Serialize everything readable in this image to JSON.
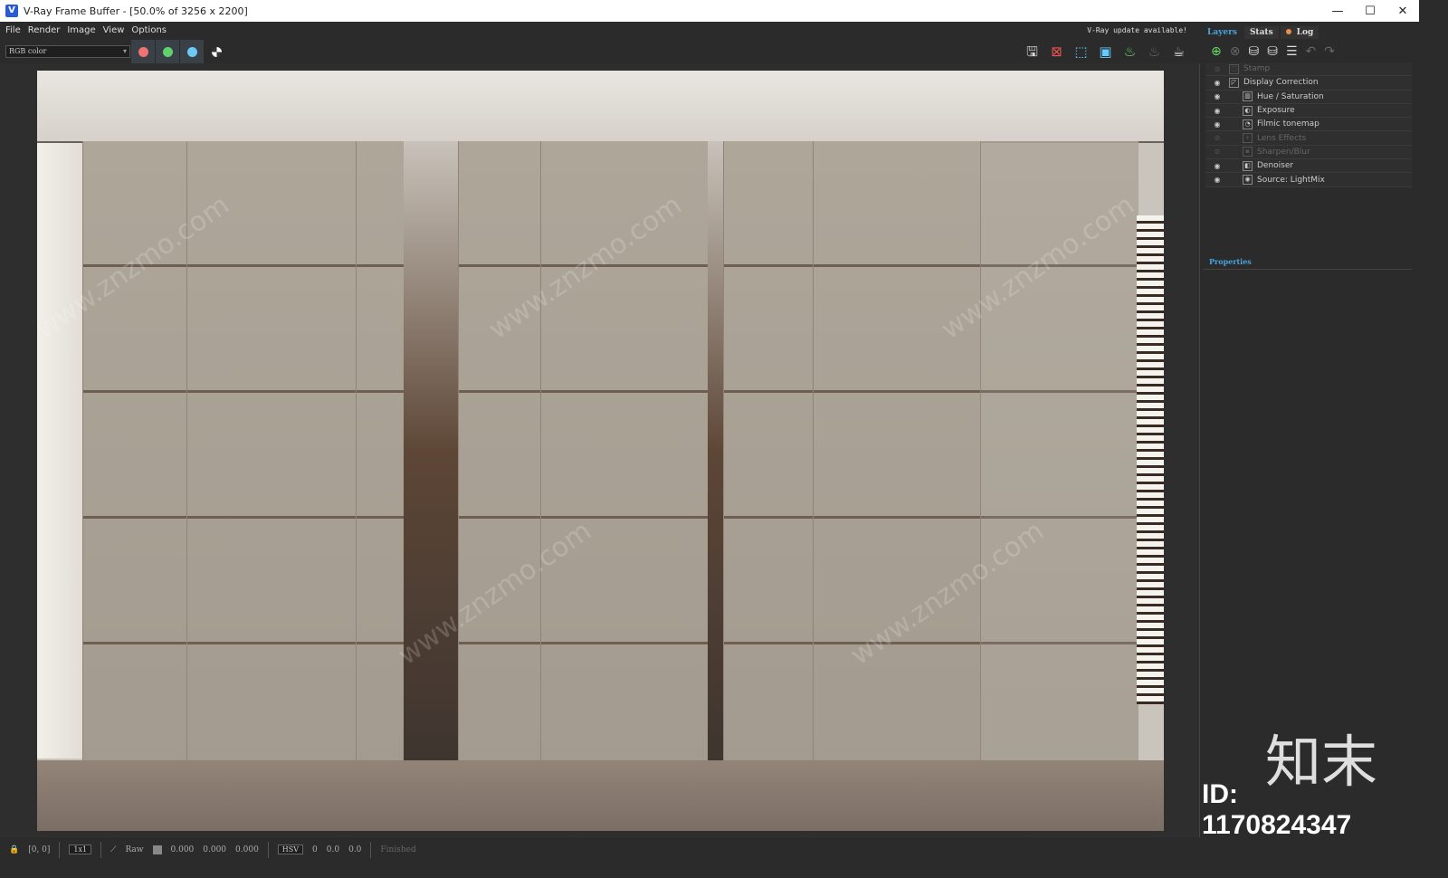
{
  "window": {
    "title": "V-Ray Frame Buffer - [50.0% of 3256 x 2200]",
    "controls": [
      "—",
      "☐",
      "✕"
    ]
  },
  "menu": [
    "File",
    "Render",
    "Image",
    "View",
    "Options"
  ],
  "update_notice": "V-Ray update available!",
  "toolbar": {
    "channel": "RGB color",
    "channel_buttons": [
      {
        "name": "red",
        "color": "#f07373"
      },
      {
        "name": "green",
        "color": "#62d06c"
      },
      {
        "name": "blue",
        "color": "#6cc9f5"
      }
    ],
    "right_icons": [
      "save-icon",
      "clear-icon",
      "region-icon",
      "compare-icon",
      "render-icon",
      "stop-icon",
      "teapot-icon"
    ]
  },
  "panel": {
    "tabs": [
      "Layers",
      "Stats",
      "Log"
    ],
    "layer_tools": [
      "add-layer-icon",
      "delete-layer-icon",
      "save-layers-icon",
      "load-layers-icon",
      "list-icon",
      "undo-icon",
      "redo-icon"
    ],
    "layers": [
      {
        "name": "Stamp",
        "visible": false,
        "indent": 0
      },
      {
        "name": "Display Correction",
        "visible": true,
        "indent": 0
      },
      {
        "name": "Hue / Saturation",
        "visible": true,
        "indent": 1
      },
      {
        "name": "Exposure",
        "visible": true,
        "indent": 1
      },
      {
        "name": "Filmic tonemap",
        "visible": true,
        "indent": 1
      },
      {
        "name": "Lens Effects",
        "visible": false,
        "indent": 1
      },
      {
        "name": "Sharpen/Blur",
        "visible": false,
        "indent": 1
      },
      {
        "name": "Denoiser",
        "visible": true,
        "indent": 1
      },
      {
        "name": "Source: LightMix",
        "visible": true,
        "indent": 1
      }
    ],
    "properties_label": "Properties"
  },
  "status": {
    "coords": "[0, 0]",
    "zoom": "1x1",
    "raw": "Raw",
    "r": "0.000",
    "g": "0.000",
    "b": "0.000",
    "mode": "HSV",
    "h": "0",
    "s": "0.0",
    "v": "0.0",
    "state": "Finished"
  },
  "watermark": {
    "text": "知末",
    "id": "ID: 1170824347",
    "site": "www.znzmo.com"
  }
}
